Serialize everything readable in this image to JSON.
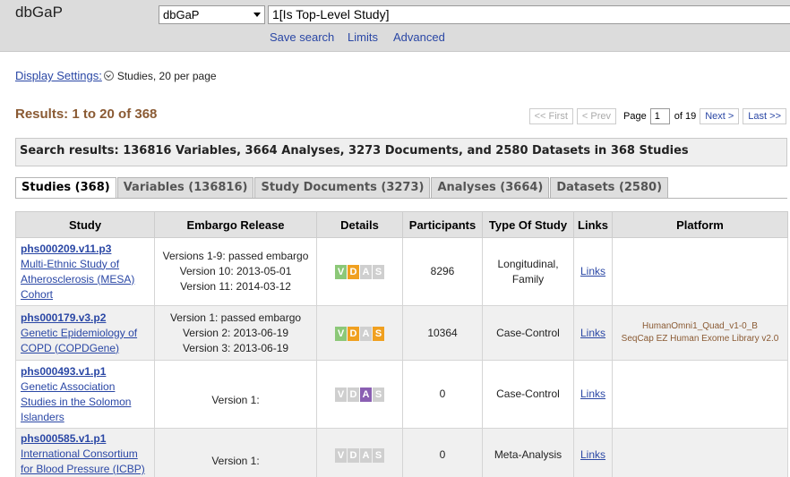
{
  "header": {
    "logo": "dbGaP",
    "db_select": "dbGaP",
    "search_value": "1[Is Top-Level Study]",
    "links": [
      "Save search",
      "Limits",
      "Advanced"
    ]
  },
  "display_settings": {
    "label": "Display Settings:",
    "value": "Studies, 20 per page"
  },
  "results_title": "Results: 1 to 20 of 368",
  "pager": {
    "first": "<< First",
    "prev": "< Prev",
    "page_label": "Page",
    "page": "1",
    "of": "of 19",
    "next": "Next >",
    "last": "Last >>"
  },
  "summary": "Search results: 136816 Variables, 3664 Analyses, 3273 Documents, and 2580 Datasets in 368 Studies",
  "tabs": [
    {
      "label": "Studies (368)",
      "active": true
    },
    {
      "label": "Variables (136816)"
    },
    {
      "label": "Study Documents (3273)"
    },
    {
      "label": "Analyses (3664)"
    },
    {
      "label": "Datasets (2580)"
    }
  ],
  "table": {
    "headers": [
      "Study",
      "Embargo Release",
      "Details",
      "Participants",
      "Type Of Study",
      "Links",
      "Platform"
    ],
    "rows": [
      {
        "id": "phs000209.v11.p3",
        "name": "Multi-Ethnic Study of Atherosclerosis (MESA) Cohort",
        "embargo": [
          "Versions 1-9: passed embargo",
          "Version 10: 2013-05-01",
          "Version 11: 2014-03-12"
        ],
        "badges": [
          "V",
          "D",
          "A",
          "S"
        ],
        "participants": "8296",
        "type": "Longitudinal, Family",
        "links": "Links",
        "platform": []
      },
      {
        "id": "phs000179.v3.p2",
        "name": "Genetic Epidemiology of COPD (COPDGene)",
        "embargo": [
          "Version 1: passed embargo",
          "Version 2: 2013-06-19",
          "Version 3: 2013-06-19"
        ],
        "badges": [
          "V",
          "D",
          "A",
          "S"
        ],
        "participants": "10364",
        "type": "Case-Control",
        "links": "Links",
        "platform": [
          "HumanOmni1_Quad_v1-0_B",
          "SeqCap EZ Human Exome Library v2.0"
        ]
      },
      {
        "id": "phs000493.v1.p1",
        "name": "Genetic Association Studies in the Solomon Islanders",
        "embargo": [
          "Version 1:"
        ],
        "badges": [
          "V",
          "D",
          "A",
          "S"
        ],
        "participants": "0",
        "type": "Case-Control",
        "links": "Links",
        "platform": []
      },
      {
        "id": "phs000585.v1.p1",
        "name": "International Consortium for Blood Pressure (ICBP)",
        "embargo": [
          "Version 1:"
        ],
        "badges": [
          "V",
          "D",
          "A",
          "S"
        ],
        "participants": "0",
        "type": "Meta-Analysis",
        "links": "Links",
        "platform": []
      }
    ]
  }
}
